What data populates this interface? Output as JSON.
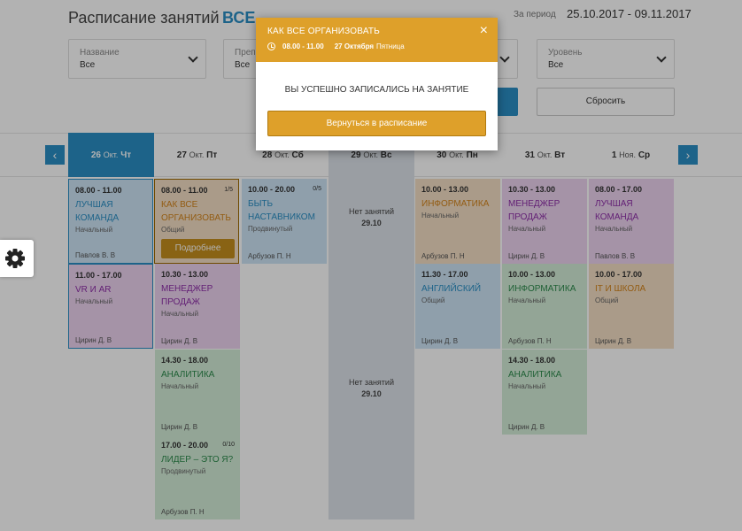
{
  "header": {
    "title": "Расписание занятий",
    "all_label": "ВСЕ",
    "period_label": "За период",
    "period_value": "25.10.2017 - 09.11.2017"
  },
  "filters": [
    {
      "label": "Название",
      "value": "Все"
    },
    {
      "label": "Преп",
      "value": "Все"
    },
    {
      "label": "Уровень",
      "value": "Все"
    }
  ],
  "buttons": {
    "reset": "Сбросить",
    "more": "Подробнее",
    "prev": "‹",
    "next": "›"
  },
  "days": [
    {
      "day": "26",
      "month": "Окт.",
      "weekday": "Чт"
    },
    {
      "day": "27",
      "month": "Окт.",
      "weekday": "Пт"
    },
    {
      "day": "28",
      "month": "Окт.",
      "weekday": "Сб"
    },
    {
      "day": "29",
      "month": "Окт.",
      "weekday": "Вс"
    },
    {
      "day": "30",
      "month": "Окт.",
      "weekday": "Пн"
    },
    {
      "day": "31",
      "month": "Окт.",
      "weekday": "Вт"
    },
    {
      "day": "1",
      "month": "Ноя.",
      "weekday": "Ср"
    }
  ],
  "no_lessons": {
    "text": "Нет занятий",
    "date": "29.10"
  },
  "lessons": [
    {
      "time": "08.00 - 11.00",
      "name": "ЛУЧШАЯ КОМАНДА",
      "level": "Начальный",
      "teacher": "Павлов В. В",
      "seats": ""
    },
    {
      "time": "08.00 - 11.00",
      "name": "КАК ВСЕ ОРГАНИЗОВАТЬ",
      "level": "Общий",
      "teacher": "",
      "seats": "1/5"
    },
    {
      "time": "10.00 - 20.00",
      "name": "БЫТЬ НАСТАВНИКОМ",
      "level": "Продвинутый",
      "teacher": "Арбузов П. Н",
      "seats": "0/5"
    },
    {
      "time": "10.00 - 13.00",
      "name": "ИНФОРМАТИКА",
      "level": "Начальный",
      "teacher": "Арбузов П. Н",
      "seats": ""
    },
    {
      "time": "10.30 - 13.00",
      "name": "МЕНЕДЖЕР ПРОДАЖ",
      "level": "Начальный",
      "teacher": "Цирин Д. В",
      "seats": ""
    },
    {
      "time": "08.00 - 17.00",
      "name": "ЛУЧШАЯ КОМАНДА",
      "level": "Начальный",
      "teacher": "Павлов В. В",
      "seats": ""
    },
    {
      "time": "11.00 - 17.00",
      "name": "VR И AR",
      "level": "Начальный",
      "teacher": "Цирин Д. В",
      "seats": ""
    },
    {
      "time": "10.30 - 13.00",
      "name": "МЕНЕДЖЕР ПРОДАЖ",
      "level": "Начальный",
      "teacher": "Цирин Д. В",
      "seats": ""
    },
    {
      "time": "11.30 - 17.00",
      "name": "АНГЛИЙСКИЙ",
      "level": "Общий",
      "teacher": "Цирин Д. В",
      "seats": ""
    },
    {
      "time": "10.00 - 13.00",
      "name": "ИНФОРМАТИКА",
      "level": "Начальный",
      "teacher": "Арбузов П. Н",
      "seats": ""
    },
    {
      "time": "10.00 - 17.00",
      "name": "IT И ШКОЛА",
      "level": "Общий",
      "teacher": "Цирин Д. В",
      "seats": ""
    },
    {
      "time": "14.30 - 18.00",
      "name": "АНАЛИТИКА",
      "level": "Начальный",
      "teacher": "Цирин Д. В",
      "seats": ""
    },
    {
      "time": "14.30 - 18.00",
      "name": "АНАЛИТИКА",
      "level": "Начальный",
      "teacher": "Цирин Д. В",
      "seats": ""
    },
    {
      "time": "17.00 - 20.00",
      "name": "ЛИДЕР – ЭТО Я?",
      "level": "Продвинутый",
      "teacher": "Арбузов П. Н",
      "seats": "0/10"
    }
  ],
  "modal": {
    "title": "КАК ВСЕ ОРГАНИЗОВАТЬ",
    "time": "08.00  -  11.00",
    "date": "27 Октября",
    "weekday": "Пятница",
    "close": "×",
    "message": "ВЫ УСПЕШНО ЗАПИСАЛИСЬ НА ЗАНЯТИЕ",
    "button": "Вернуться в расписание"
  },
  "colors": {
    "accent": "#2a8fc4",
    "modal": "#dea02a",
    "blue": "#cde4f5",
    "purple": "#ecd3f0",
    "orange": "#f4dfc5",
    "green": "#d3ecd7"
  },
  "icons": {
    "settings": "gear-icon",
    "close": "close-icon",
    "clock": "clock-icon"
  }
}
